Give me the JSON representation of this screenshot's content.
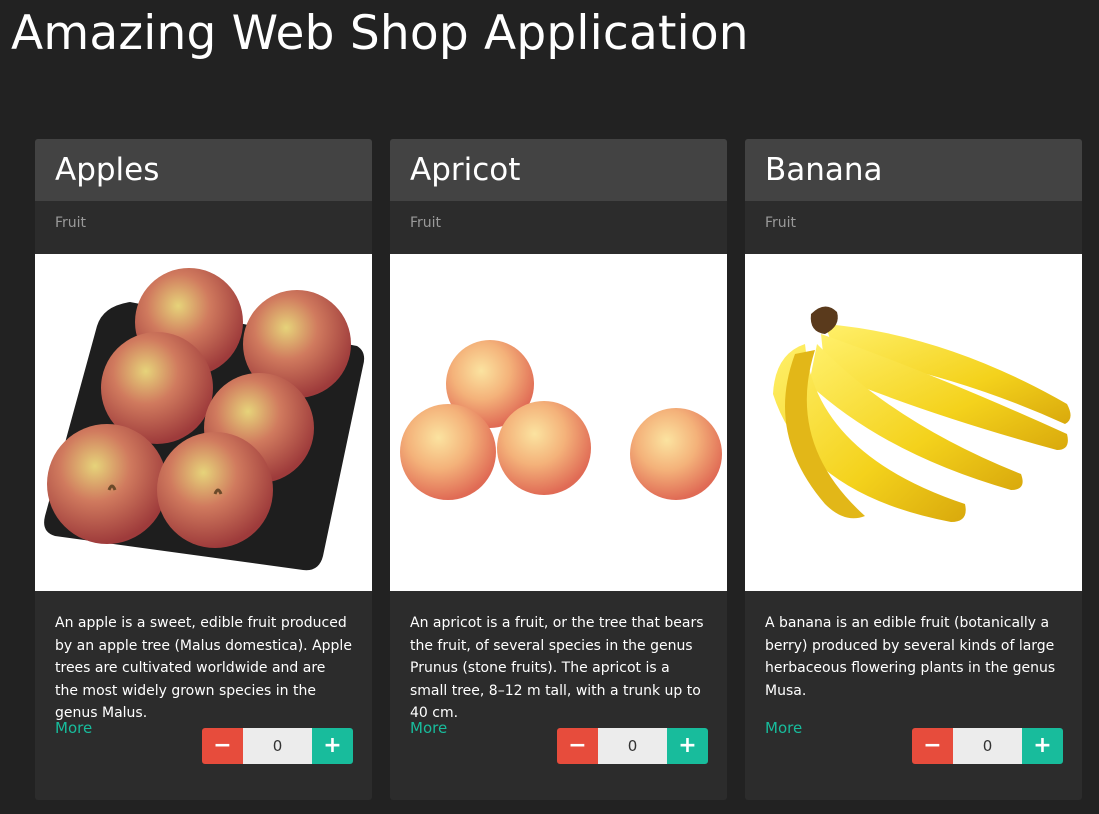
{
  "app": {
    "title": "Amazing Web Shop Application"
  },
  "products": [
    {
      "name": "Apples",
      "category": "Fruit",
      "description": "An apple is a sweet, edible fruit produced by an apple tree (Malus domestica). Apple trees are cultivated worldwide and are the most widely grown species in the genus Malus.",
      "more_label": "More",
      "quantity": "0",
      "minus_icon": "minus-icon",
      "plus_icon": "plus-icon"
    },
    {
      "name": "Apricot",
      "category": "Fruit",
      "description": "An apricot is a fruit, or the tree that bears the fruit, of several species in the genus Prunus (stone fruits). The apricot is a small tree, 8–12 m tall, with a trunk up to 40 cm.",
      "more_label": "More",
      "quantity": "0",
      "minus_icon": "minus-icon",
      "plus_icon": "plus-icon"
    },
    {
      "name": "Banana",
      "category": "Fruit",
      "description": "A banana is an edible fruit (botanically a berry) produced by several kinds of large herbaceous flowering plants in the genus Musa.",
      "more_label": "More",
      "quantity": "0",
      "minus_icon": "minus-icon",
      "plus_icon": "plus-icon"
    }
  ],
  "colors": {
    "background": "#222222",
    "card": "#2c2c2c",
    "card_header": "#434343",
    "accent": "#18bc9c",
    "danger": "#e74c3c"
  }
}
